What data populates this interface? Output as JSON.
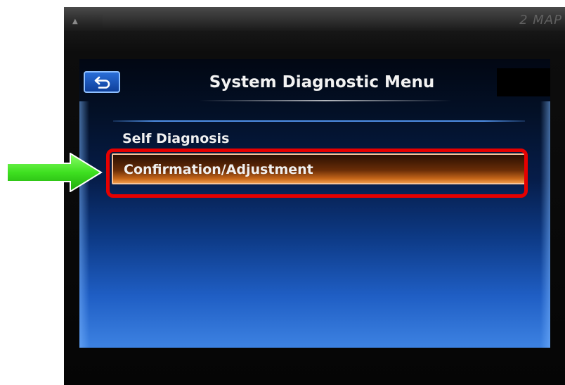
{
  "device": {
    "eject_glyph": "▲",
    "brand_text": "2 MAP"
  },
  "screen": {
    "back_icon": "back-return-icon",
    "title": "System Diagnostic Menu",
    "menu_items": [
      {
        "label": "Self Diagnosis",
        "selected": false
      },
      {
        "label": "Confirmation/Adjustment",
        "selected": true
      }
    ]
  },
  "annotation": {
    "arrow_icon": "green-right-arrow",
    "arrow_color": "#3ee020",
    "highlight_color": "#e60000"
  },
  "colors": {
    "screen_blue": "#1f5ec4",
    "selection_orange": "#c7671a"
  }
}
